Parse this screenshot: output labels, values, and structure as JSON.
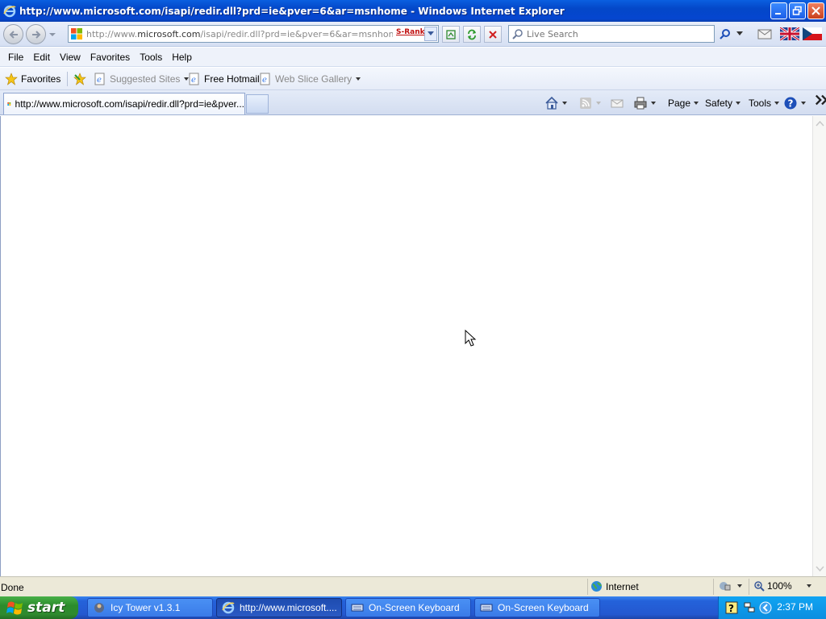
{
  "window": {
    "title": "http://www.microsoft.com/isapi/redir.dll?prd=ie&pver=6&ar=msnhome - Windows Internet Explorer"
  },
  "address_bar": {
    "url_prefix": "http://www.",
    "url_domain": "microsoft.com",
    "url_rest": "/isapi/redir.dll?prd=ie&pver=6&ar=msnhome",
    "srank_label": "S-Rank"
  },
  "search": {
    "placeholder": "Live Search"
  },
  "menu": {
    "items": [
      "File",
      "Edit",
      "View",
      "Favorites",
      "Tools",
      "Help"
    ]
  },
  "favorites_bar": {
    "favorites_label": "Favorites",
    "suggested_sites": "Suggested Sites",
    "free_hotmail": "Free Hotmail",
    "web_slice_gallery": "Web Slice Gallery"
  },
  "tabs": {
    "active_tab_label": "http://www.microsoft.com/isapi/redir.dll?prd=ie&pver..."
  },
  "command_bar": {
    "page_label": "Page",
    "safety_label": "Safety",
    "tools_label": "Tools"
  },
  "status_bar": {
    "status_text": "Done",
    "zone_text": "Internet",
    "zoom_text": "100%"
  },
  "taskbar": {
    "start_label": "start",
    "buttons": [
      {
        "label": "Icy Tower v1.3.1"
      },
      {
        "label": "http://www.microsoft...."
      },
      {
        "label": "On-Screen Keyboard"
      },
      {
        "label": "On-Screen Keyboard"
      }
    ],
    "clock": "2:37 PM"
  },
  "colors": {
    "titlebar_blue": "#0546d0",
    "taskbar_blue": "#2458d0",
    "start_green": "#2e8a2e"
  }
}
